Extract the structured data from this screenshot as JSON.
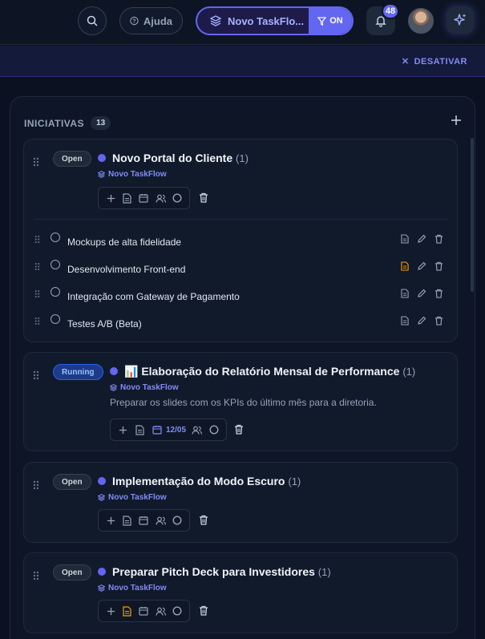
{
  "header": {
    "help_label": "Ajuda",
    "project_label": "Novo TaskFlo...",
    "filter_state": "ON",
    "notification_count": "48",
    "deactivate_label": "DESATIVAR"
  },
  "panel": {
    "title": "INICIATIVAS",
    "count": "13"
  },
  "colors": {
    "accent": "#6366f1",
    "highlight_doc": "#f59e0b"
  },
  "initiatives": [
    {
      "status": "Open",
      "title": "Novo Portal do Cliente",
      "count": "(1)",
      "project": "Novo TaskFlow",
      "subtasks": [
        {
          "label": "Mockups de alta fidelidade"
        },
        {
          "label": "Desenvolvimento Front-end"
        },
        {
          "label": "Integração com Gateway de Pagamento"
        },
        {
          "label": "Testes A/B (Beta)"
        }
      ]
    },
    {
      "status": "Running",
      "emoji": "📊",
      "title": "Elaboração do Relatório Mensal de Performance",
      "count": "(1)",
      "project": "Novo TaskFlow",
      "description": "Preparar os slides com os KPIs do último mês para a diretoria.",
      "date": "12/05"
    },
    {
      "status": "Open",
      "title": "Implementação do Modo Escuro",
      "count": "(1)",
      "project": "Novo TaskFlow"
    },
    {
      "status": "Open",
      "title": "Preparar Pitch Deck para Investidores",
      "count": "(1)",
      "project": "Novo TaskFlow"
    }
  ]
}
